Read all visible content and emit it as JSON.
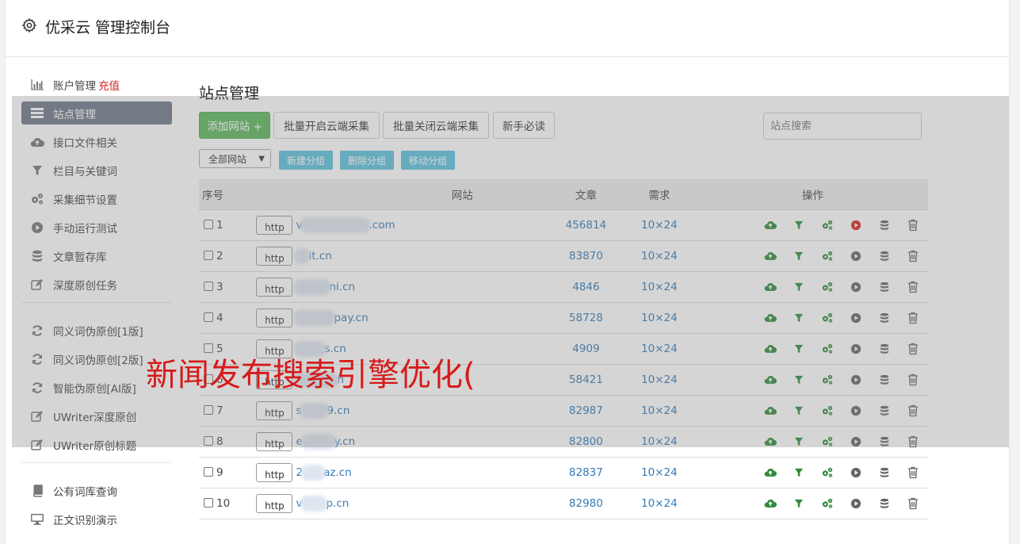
{
  "header": {
    "title": "优采云 管理控制台",
    "icon": "gear-icon"
  },
  "sidebar": {
    "account": {
      "label": "账户管理",
      "recharge": "充值"
    },
    "items": [
      {
        "label": "站点管理",
        "icon": "list-icon",
        "active": true
      },
      {
        "label": "接口文件相关",
        "icon": "cloud-upload-icon"
      },
      {
        "label": "栏目与关键词",
        "icon": "filter-icon"
      },
      {
        "label": "采集细节设置",
        "icon": "gears-icon"
      },
      {
        "label": "手动运行测试",
        "icon": "play-icon"
      },
      {
        "label": "文章暂存库",
        "icon": "database-icon"
      },
      {
        "label": "深度原创任务",
        "icon": "edit-icon"
      }
    ],
    "group2": [
      {
        "label": "同义词伪原创[1版]",
        "icon": "refresh-icon"
      },
      {
        "label": "同义词伪原创[2版]",
        "icon": "refresh-icon"
      },
      {
        "label": "智能伪原创[AI版]",
        "icon": "refresh-icon"
      },
      {
        "label": "UWriter深度原创",
        "icon": "edit-icon"
      },
      {
        "label": "UWriter原创标题",
        "icon": "edit-icon"
      }
    ],
    "group3": [
      {
        "label": "公有词库查询",
        "icon": "book-icon"
      },
      {
        "label": "正文识别演示",
        "icon": "monitor-icon"
      }
    ]
  },
  "main": {
    "title": "站点管理",
    "toolbar": {
      "add_site": "添加网站 +",
      "batch_enable": "批量开启云端采集",
      "batch_disable": "批量关闭云端采集",
      "newbie": "新手必读",
      "search_placeholder": "站点搜索"
    },
    "group_filter": {
      "selected": "全部网站",
      "new_group": "新建分组",
      "delete_group": "删除分组",
      "move_group": "移动分组"
    },
    "table": {
      "headers": {
        "no": "序号",
        "site": "网站",
        "articles": "文章",
        "demand": "需求",
        "ops": "操作"
      },
      "rows": [
        {
          "no": "1",
          "protocol": "http",
          "prefix": "v",
          "suffix": ".com",
          "articles": "456814",
          "demand": "10×24",
          "play_active": true
        },
        {
          "no": "2",
          "protocol": "http",
          "prefix": "",
          "suffix": "it.cn",
          "articles": "83870",
          "demand": "10×24",
          "play_active": false
        },
        {
          "no": "3",
          "protocol": "http",
          "prefix": "",
          "suffix": "ni.cn",
          "articles": "4846",
          "demand": "10×24",
          "play_active": false
        },
        {
          "no": "4",
          "protocol": "http",
          "prefix": "",
          "suffix": "pay.cn",
          "articles": "58728",
          "demand": "10×24",
          "play_active": false
        },
        {
          "no": "5",
          "protocol": "http",
          "prefix": "",
          "suffix": "s.cn",
          "articles": "4909",
          "demand": "10×24",
          "play_active": false
        },
        {
          "no": "6",
          "protocol": "http",
          "prefix": "",
          "suffix": "n",
          "articles": "58421",
          "demand": "10×24",
          "play_active": false
        },
        {
          "no": "7",
          "protocol": "http",
          "prefix": "s",
          "suffix": "9.cn",
          "articles": "82987",
          "demand": "10×24",
          "play_active": false
        },
        {
          "no": "8",
          "protocol": "http",
          "prefix": "e",
          "suffix": "y.cn",
          "articles": "82800",
          "demand": "10×24",
          "play_active": false
        },
        {
          "no": "9",
          "protocol": "http",
          "prefix": "2",
          "suffix": "az.cn",
          "articles": "82837",
          "demand": "10×24",
          "play_active": false
        },
        {
          "no": "10",
          "protocol": "http",
          "prefix": "v",
          "suffix": "p.cn",
          "articles": "82980",
          "demand": "10×24",
          "play_active": false
        }
      ]
    }
  },
  "overlay": {
    "text": "新闻发布搜索引擎优化("
  },
  "colors": {
    "accent_green": "#5cb85c",
    "info_blue": "#5bc0de",
    "link_blue": "#337ab7",
    "active_nav": "#6e7888",
    "red": "#d9231d",
    "icon_green": "#2e8b3a"
  }
}
